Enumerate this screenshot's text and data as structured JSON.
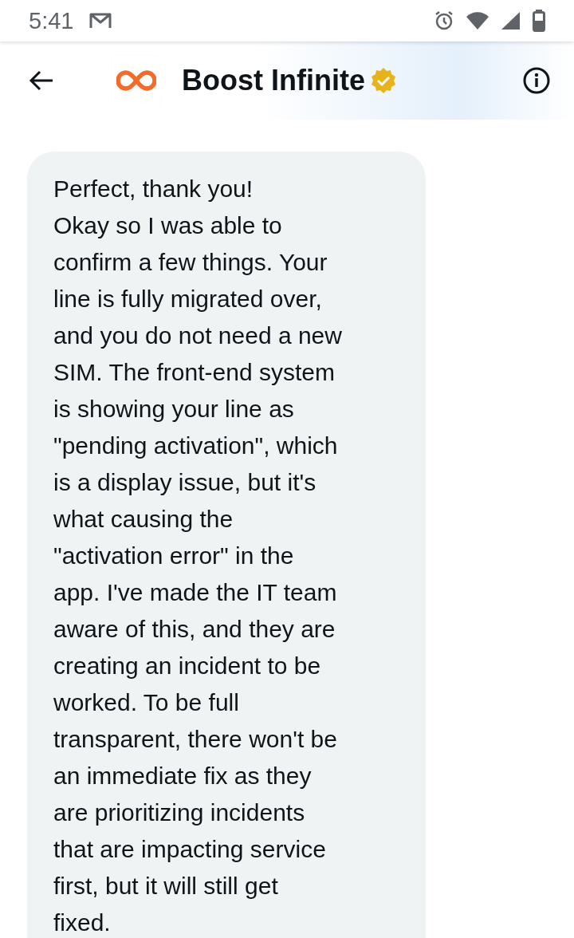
{
  "status_bar": {
    "time": "5:41"
  },
  "header": {
    "title": "Boost Infinite",
    "verified": true
  },
  "messages": [
    {
      "kind": "incoming",
      "text": "Perfect, thank you!\nOkay so I was able to\nconfirm a few things. Your\nline is fully migrated over,\nand you do not need a new\nSIM. The front-end system\nis showing your line as\n\"pending activation\", which\nis a display issue, but it's\nwhat causing the\n\"activation error\" in the\napp. I've made the IT team\naware of this, and they are\ncreating an incident to be\nworked. To be full\ntransparent, there won't be\nan immediate fix as they\nare prioritizing incidents\nthat are impacting service\nfirst, but it will still get\nfixed."
    }
  ]
}
